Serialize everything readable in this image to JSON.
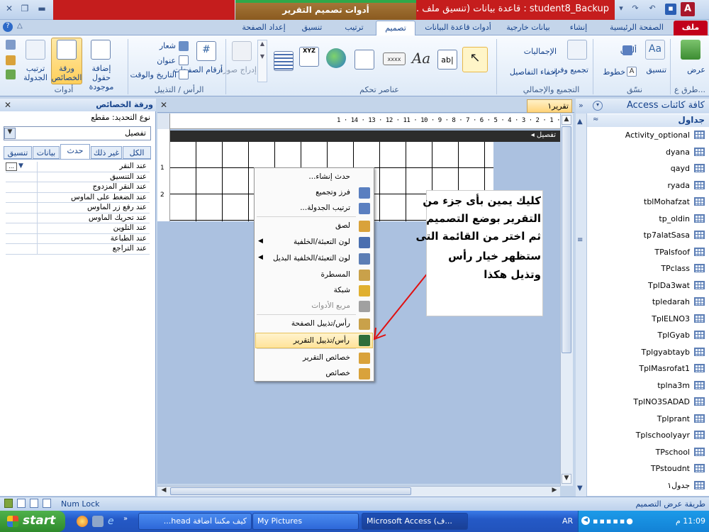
{
  "window": {
    "title": "student8_Backup : قاعدة بيانات (تنسيق ملف ...",
    "context_title": "أدوات تصميم التقرير",
    "app_icon": "A"
  },
  "tabs": [
    {
      "label": "ملف"
    },
    {
      "label": "الصفحة الرئيسية"
    },
    {
      "label": "إنشاء"
    },
    {
      "label": "بيانات خارجية"
    },
    {
      "label": "أدوات قاعدة البيانات"
    },
    {
      "label": "تصميم"
    },
    {
      "label": "ترتيب"
    },
    {
      "label": "تنسيق"
    },
    {
      "label": "إعداد الصفحة"
    }
  ],
  "ribbon": {
    "views": {
      "label": "عرض",
      "group": "طرق ع..."
    },
    "text_formatting": {
      "paste": "لصق",
      "format": "تنسيق",
      "font": "خطوط",
      "colors": "ألوان",
      "group": "نسّق"
    },
    "grouping": {
      "group_sort": "تجميع وفرز",
      "totals": "الإجماليات",
      "hide_details": "إخفاء التفاصيل",
      "group": "التجميع والإجمالي"
    },
    "controls": {
      "group": "عناصر تحكم",
      "insert_image": "إدراج صورة"
    },
    "header_footer": {
      "page_numbers": "أرقام الصفحات",
      "logo": "شعار",
      "title": "عنوان",
      "date_time": "التاريخ والوقت",
      "group": "الرأس / التذييل"
    },
    "tools": {
      "add_fields": "إضافة حقول موجودة",
      "property_sheet": "ورقة الخصائص",
      "tab_order": "ترتيب الجدولة",
      "group": "أدوات"
    }
  },
  "property_sheet": {
    "title": "ورقة الخصائص",
    "selection_type": "نوع التحديد: مقطع",
    "selected": "تفصيل",
    "tabs": [
      "تنسيق",
      "بيانات",
      "حدث",
      "غير ذلك",
      "الكل"
    ],
    "rows": [
      "عند النقر",
      "عند التنسيق",
      "عند النقر المزدوج",
      "عند الضغط على الماوس",
      "عند رفع زر الماوس",
      "عند تحريك الماوس",
      "عند التلوين",
      "عند الطباعة",
      "عند التراجع"
    ]
  },
  "document": {
    "tab_label": "تقرير١",
    "section_label": "تفصيل",
    "ruler": "· 1 · 2 · 3 · 4 · 5 · 6 · 7 · 8 · 9 · 10 · 11 · 12 · 13 · 14 · 1"
  },
  "context_menu": [
    {
      "label": "حدث إنشاء...",
      "disabled": false
    },
    {
      "label": "فرز وتجميع",
      "disabled": false
    },
    {
      "label": "ترتيب الجدولة...",
      "disabled": false
    },
    {
      "label": "لصق",
      "disabled": false
    },
    {
      "label": "لون التعبئة/الخلفية",
      "disabled": false
    },
    {
      "label": "لون التعبئة/الخلفية البديل",
      "disabled": false
    },
    {
      "label": "المسطرة",
      "disabled": false
    },
    {
      "label": "شبكة",
      "disabled": false
    },
    {
      "label": "مربع الأدوات",
      "disabled": true
    },
    {
      "label": "رأس/تذييل الصفحة",
      "disabled": false
    },
    {
      "label": "رأس/تذييل التقرير",
      "disabled": false
    },
    {
      "label": "خصائص التقرير",
      "disabled": false
    },
    {
      "label": "خصائص",
      "disabled": false
    }
  ],
  "callout": {
    "lines": [
      "كليك يمين بأى جزء من",
      "التقرير بوضع التصميم",
      "ثم اختر من القائمة التى",
      "ستظهر خيار رأس",
      "وتذيل هكذا"
    ]
  },
  "nav_pane": {
    "title": "كافة كائنات Access",
    "group": "جداول",
    "tables": [
      "Activity_optional",
      "dyana",
      "qayd",
      "ryada",
      "tblMohafzat",
      "tp_oldin",
      "tp7alatSasa",
      "TPalsfoof",
      "TPclass",
      "TplDa3wat",
      "tpledarah",
      "TplELNO3",
      "TplGyab",
      "Tplgyabtayb",
      "TplMasrofat1",
      "tplna3m",
      "TplNO3SADAD",
      "Tplprant",
      "Tplschoolyayr",
      "TPschool",
      "TPstoudnt",
      "جدول١"
    ]
  },
  "status_bar": {
    "num_lock": "Num Lock",
    "view": "طريقة عرض التصميم"
  },
  "taskbar": {
    "start": "start",
    "buttons": [
      "كيف مكننا اضافة head...",
      "My Pictures",
      "Microsoft Access (ف..."
    ],
    "language": "AR",
    "clock": "11:09 م"
  },
  "colors": {
    "title_red": "#c51d1d",
    "context_gold": "#a87a3c",
    "taskbar_blue": "#2459c6",
    "start_green": "#3a9a36",
    "menu_highlight": "#ffe39a"
  }
}
